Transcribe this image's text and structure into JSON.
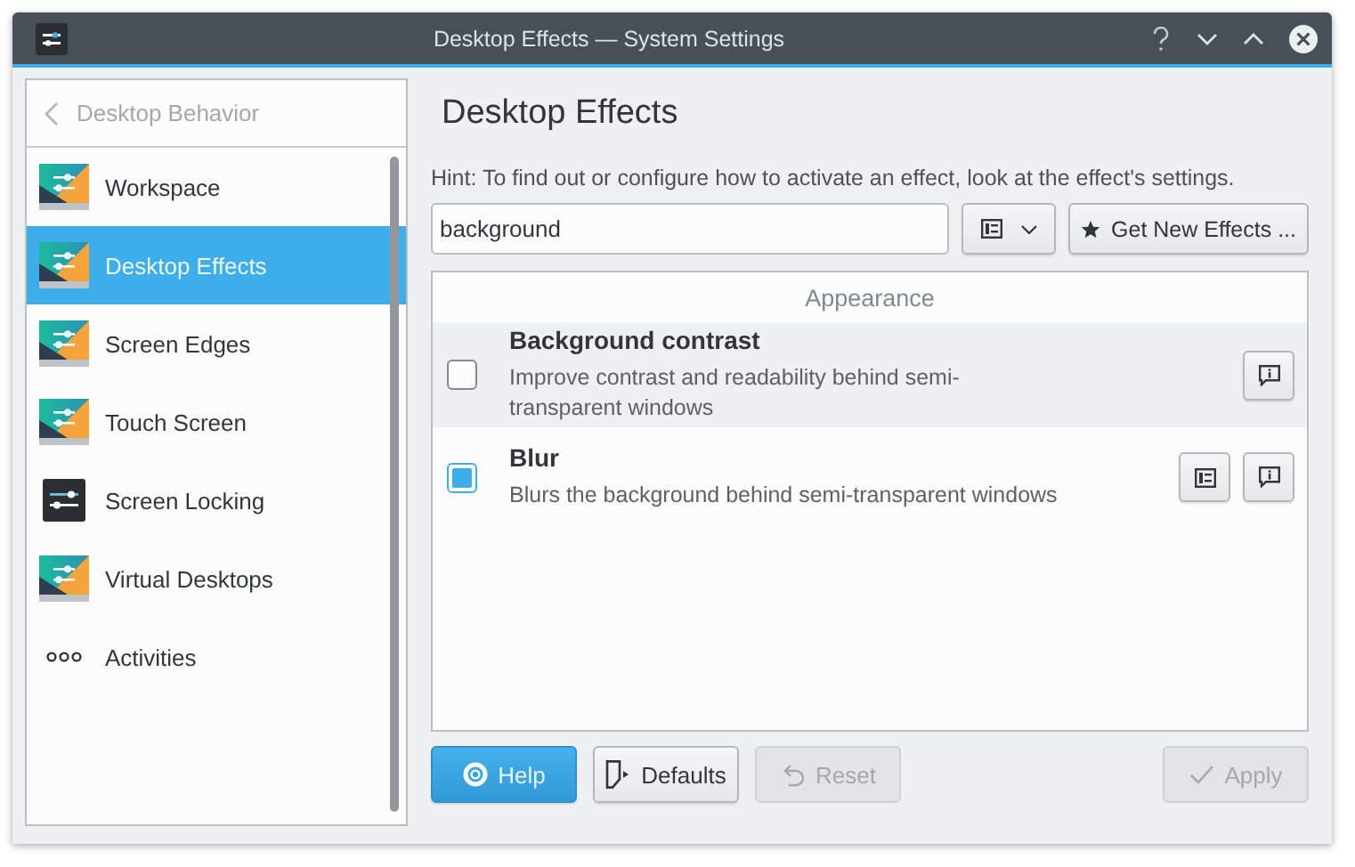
{
  "window": {
    "title": "Desktop Effects — System Settings"
  },
  "sidebar": {
    "back_label": "Desktop Behavior",
    "items": [
      {
        "label": "Workspace",
        "kind": "desktop",
        "selected": false
      },
      {
        "label": "Desktop Effects",
        "kind": "desktop",
        "selected": true
      },
      {
        "label": "Screen Edges",
        "kind": "desktop",
        "selected": false
      },
      {
        "label": "Touch Screen",
        "kind": "desktop",
        "selected": false
      },
      {
        "label": "Screen Locking",
        "kind": "lock",
        "selected": false
      },
      {
        "label": "Virtual Desktops",
        "kind": "desktop",
        "selected": false
      },
      {
        "label": "Activities",
        "kind": "dots",
        "selected": false
      }
    ]
  },
  "page": {
    "title": "Desktop Effects",
    "hint": "Hint: To find out or configure how to activate an effect, look at the effect's settings.",
    "search": {
      "value": "background"
    },
    "get_new_label": "Get New Effects ...",
    "group": "Appearance",
    "effects": [
      {
        "name": "Background contrast",
        "description": "Improve contrast and readability behind semi-transparent windows",
        "checked": false,
        "configurable": false
      },
      {
        "name": "Blur",
        "description": "Blurs the background behind semi-transparent windows",
        "checked": true,
        "configurable": true
      }
    ]
  },
  "buttons": [
    {
      "label": "Help",
      "kind": "help",
      "disabled": false
    },
    {
      "label": "Defaults",
      "kind": "defaults",
      "disabled": false
    },
    {
      "label": "Reset",
      "kind": "reset",
      "disabled": true
    },
    {
      "label": "Apply",
      "kind": "apply",
      "disabled": true
    }
  ]
}
